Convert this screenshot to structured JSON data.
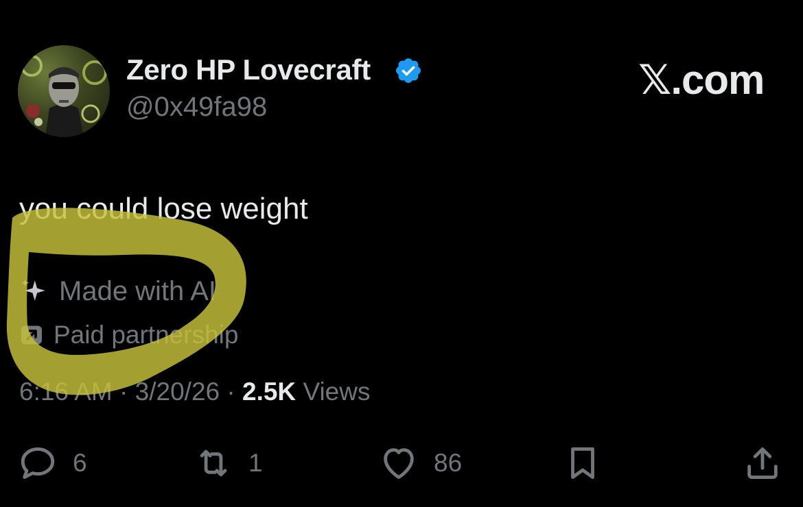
{
  "author": {
    "display_name": "Zero HP Lovecraft",
    "handle": "@0x49fa98",
    "verified": true,
    "badge_color": "#1d9bf0"
  },
  "brand": {
    "label": "𝕏.com"
  },
  "tweet": {
    "text": "you could lose weight"
  },
  "labels": {
    "made_with_ai": "Made with AI",
    "paid_partnership": "Paid partnership"
  },
  "meta": {
    "time": "6:16 AM",
    "date": "3/20/26",
    "views_count": "2.5K",
    "views_label": "Views",
    "separator": "·"
  },
  "actions": {
    "replies": "6",
    "reposts": "1",
    "likes": "86"
  },
  "colors": {
    "background": "#000000",
    "primary_text": "#e7e9ea",
    "secondary_text": "#71767b",
    "highlight": "#c7c23a"
  },
  "icons": [
    "verified-badge-icon",
    "sparkle-icon",
    "paid-partnership-icon",
    "reply-icon",
    "repost-icon",
    "like-icon",
    "bookmark-icon",
    "share-icon"
  ]
}
